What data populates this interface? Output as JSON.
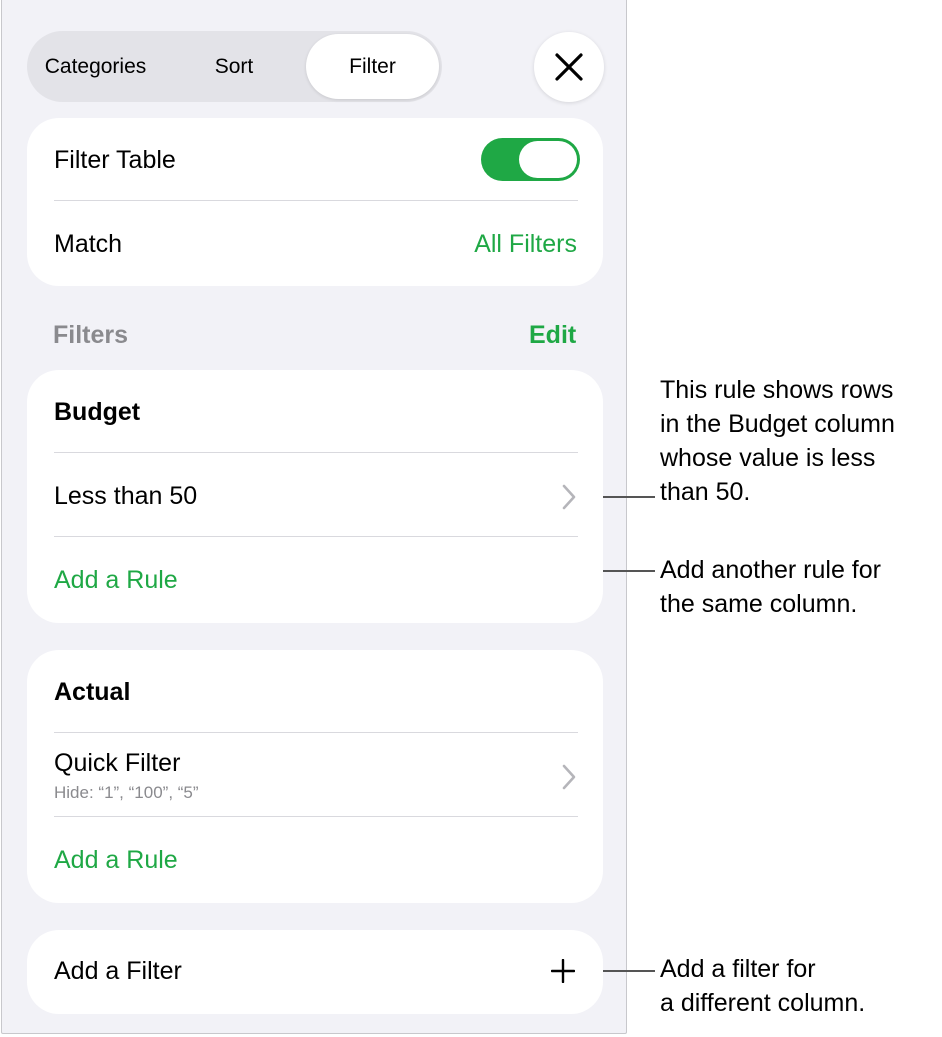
{
  "segmented": {
    "categories": "Categories",
    "sort": "Sort",
    "filter": "Filter"
  },
  "close_icon": "close-icon",
  "filter_table": {
    "label": "Filter Table",
    "enabled": true
  },
  "match": {
    "label": "Match",
    "value": "All Filters"
  },
  "filters_header": {
    "title": "Filters",
    "edit": "Edit"
  },
  "groups": [
    {
      "column": "Budget",
      "rule": "Less than 50",
      "add_rule": "Add a Rule"
    },
    {
      "column": "Actual",
      "rule": "Quick Filter",
      "rule_detail": "Hide: “1”, “100”, “5”",
      "add_rule": "Add a Rule"
    }
  ],
  "add_filter": {
    "label": "Add a Filter"
  },
  "callouts": [
    {
      "lines": [
        "This rule shows rows",
        "in the Budget column",
        "whose value is less",
        "than 50."
      ]
    },
    {
      "lines": [
        "Add another rule for",
        "the same column."
      ]
    },
    {
      "lines": [
        "Add a filter for",
        "a different column."
      ]
    }
  ],
  "colors": {
    "accent": "#1fa845",
    "panel_bg": "#f2f2f7",
    "card_bg": "#ffffff"
  }
}
